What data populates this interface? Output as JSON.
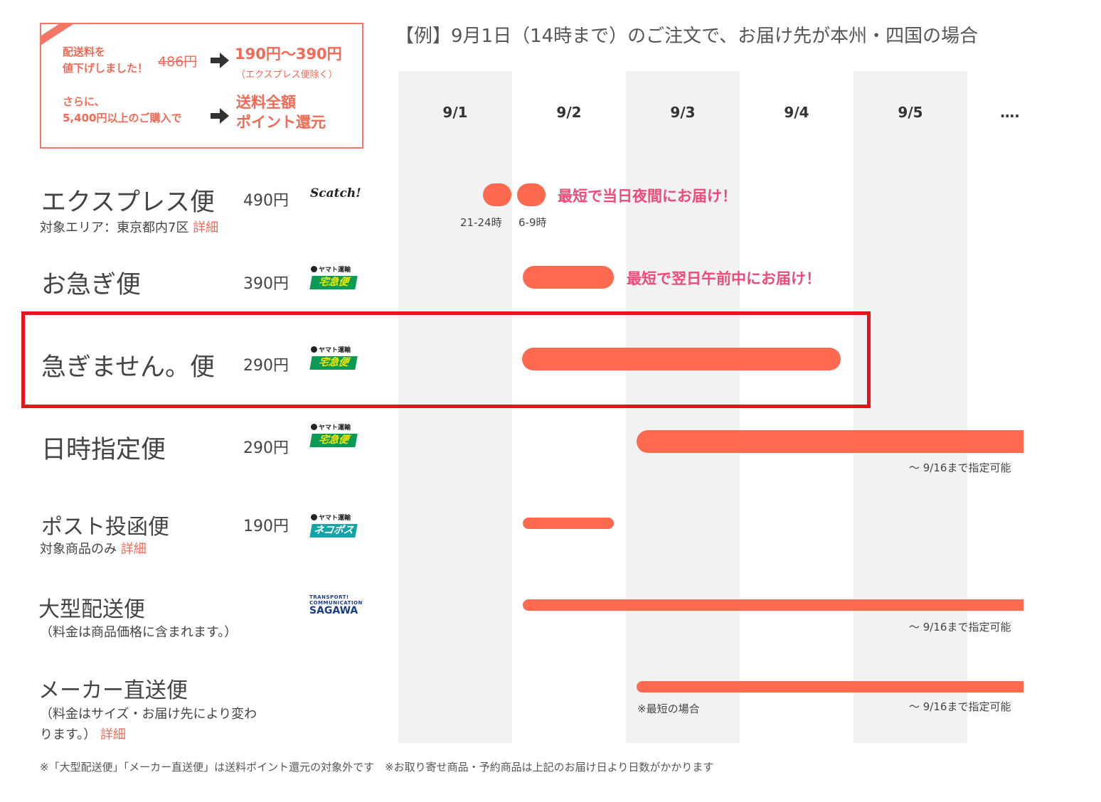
{
  "promo": {
    "line1a": "配送料を",
    "line1b": "値下げしました！",
    "old_price": "486円",
    "new_price": "190円〜390円",
    "new_price_note": "（エクスプレス便除く）",
    "line2a": "さらに、",
    "line2b": "5,400円以上のご購入で",
    "benefit_a": "送料全額",
    "benefit_b": "ポイント還元",
    "accent_color": "#f06a55"
  },
  "example_title": "【例】9月1日（14時まで）のご注文で、お届け先が本州・四国の場合",
  "dates": [
    "9/1",
    "9/2",
    "9/3",
    "9/4",
    "9/5",
    "…."
  ],
  "rows": {
    "express": {
      "name": "エクスプレス便",
      "price": "490円",
      "sub": "対象エリア：東京都内7区",
      "detail": "詳細",
      "logo": "Scatch!",
      "label": "最短で当日夜間にお届け！",
      "time1": "21-24時",
      "time2": "6-9時"
    },
    "isogi": {
      "name": "お急ぎ便",
      "price": "390円",
      "label": "最短で翌日午前中にお届け！"
    },
    "isogimasen": {
      "name": "急ぎません。便",
      "price": "290円"
    },
    "nichiji": {
      "name": "日時指定便",
      "price": "290円",
      "note": "〜 9/16まで指定可能"
    },
    "post": {
      "name": "ポスト投函便",
      "price": "190円",
      "sub": "対象商品のみ",
      "detail": "詳細"
    },
    "ogata": {
      "name": "大型配送便",
      "sub": "（料金は商品価格に含まれます。）",
      "note": "〜 9/16まで指定可能"
    },
    "maker": {
      "name": "メーカー直送便",
      "sub1": "（料金はサイズ・お届け先により変わ",
      "sub2": "ります。）",
      "detail": "詳細",
      "note_left": "※最短の場合",
      "note": "〜 9/16まで指定可能"
    }
  },
  "logos": {
    "yamato_top": "ヤマト運輸",
    "takkyubin": "宅急便",
    "nekopos": "ネコポス",
    "sagawa_l1": "TRANSPORT! COMMUNICATION",
    "sagawa_l2": "SAGAWA"
  },
  "footnote": "※「大型配送便」「メーカー直送便」は送料ポイント還元の対象外です　※お取り寄せ商品・予約商品は上記のお届け日より日数がかかります",
  "colors": {
    "bar": "#ff6950",
    "label_pink": "#ef4a7a",
    "highlight": "#e8131b",
    "stripe": "#f2f2f2"
  }
}
